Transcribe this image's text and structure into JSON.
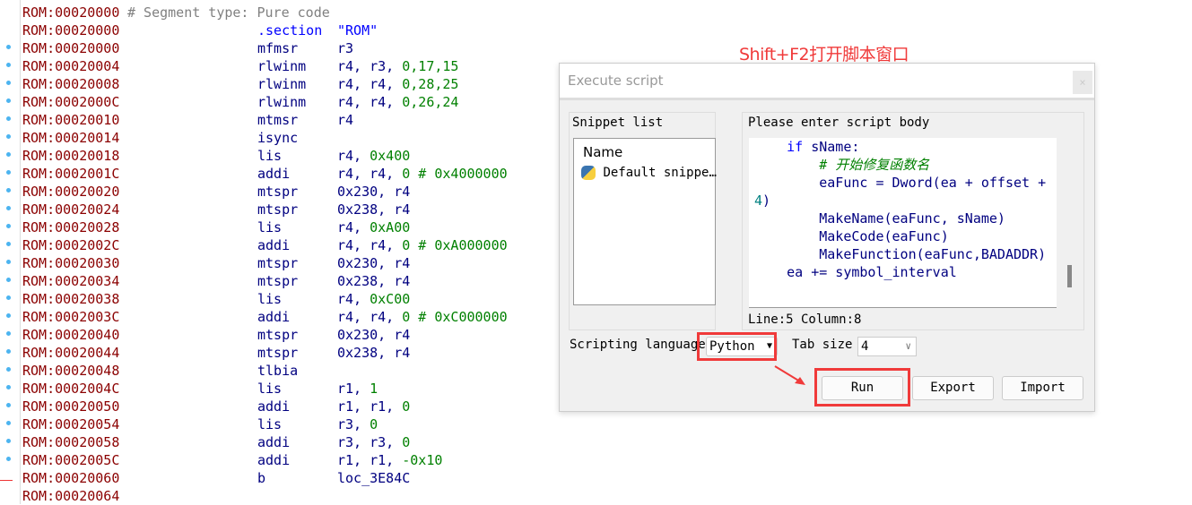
{
  "listing": [
    {
      "addr": "ROM:00020000",
      "comment": "# Segment type: Pure code",
      "dot": false
    },
    {
      "addr": "ROM:00020000",
      "mn": ".section",
      "mnKind": "dir",
      "ops": [
        {
          "t": "\"ROM\"",
          "k": "str"
        }
      ],
      "dot": false
    },
    {
      "addr": "ROM:00020000",
      "mn": "mfmsr",
      "ops": [
        {
          "t": "r3",
          "k": "reg"
        }
      ],
      "dot": true
    },
    {
      "addr": "ROM:00020004",
      "mn": "rlwinm",
      "ops": [
        {
          "t": "r4, r3, ",
          "k": "reg"
        },
        {
          "t": "0,17,15",
          "k": "num"
        }
      ],
      "dot": true
    },
    {
      "addr": "ROM:00020008",
      "mn": "rlwinm",
      "ops": [
        {
          "t": "r4, r4, ",
          "k": "reg"
        },
        {
          "t": "0,28,25",
          "k": "num"
        }
      ],
      "dot": true
    },
    {
      "addr": "ROM:0002000C",
      "mn": "rlwinm",
      "ops": [
        {
          "t": "r4, r4, ",
          "k": "reg"
        },
        {
          "t": "0,26,24",
          "k": "num"
        }
      ],
      "dot": true
    },
    {
      "addr": "ROM:00020010",
      "mn": "mtmsr",
      "ops": [
        {
          "t": "r4",
          "k": "reg"
        }
      ],
      "dot": true
    },
    {
      "addr": "ROM:00020014",
      "mn": "isync",
      "ops": [],
      "dot": true
    },
    {
      "addr": "ROM:00020018",
      "mn": "lis",
      "ops": [
        {
          "t": "r4, ",
          "k": "reg"
        },
        {
          "t": "0x400",
          "k": "num"
        }
      ],
      "dot": true
    },
    {
      "addr": "ROM:0002001C",
      "mn": "addi",
      "ops": [
        {
          "t": "r4, r4, ",
          "k": "reg"
        },
        {
          "t": "0 # 0x4000000",
          "k": "num"
        }
      ],
      "dot": true
    },
    {
      "addr": "ROM:00020020",
      "mn": "mtspr",
      "ops": [
        {
          "t": "0x230, r4",
          "k": "reg"
        }
      ],
      "dot": true
    },
    {
      "addr": "ROM:00020024",
      "mn": "mtspr",
      "ops": [
        {
          "t": "0x238, r4",
          "k": "reg"
        }
      ],
      "dot": true
    },
    {
      "addr": "ROM:00020028",
      "mn": "lis",
      "ops": [
        {
          "t": "r4, ",
          "k": "reg"
        },
        {
          "t": "0xA00",
          "k": "num"
        }
      ],
      "dot": true
    },
    {
      "addr": "ROM:0002002C",
      "mn": "addi",
      "ops": [
        {
          "t": "r4, r4, ",
          "k": "reg"
        },
        {
          "t": "0 # 0xA000000",
          "k": "num"
        }
      ],
      "dot": true
    },
    {
      "addr": "ROM:00020030",
      "mn": "mtspr",
      "ops": [
        {
          "t": "0x230, r4",
          "k": "reg"
        }
      ],
      "dot": true
    },
    {
      "addr": "ROM:00020034",
      "mn": "mtspr",
      "ops": [
        {
          "t": "0x238, r4",
          "k": "reg"
        }
      ],
      "dot": true
    },
    {
      "addr": "ROM:00020038",
      "mn": "lis",
      "ops": [
        {
          "t": "r4, ",
          "k": "reg"
        },
        {
          "t": "0xC00",
          "k": "num"
        }
      ],
      "dot": true
    },
    {
      "addr": "ROM:0002003C",
      "mn": "addi",
      "ops": [
        {
          "t": "r4, r4, ",
          "k": "reg"
        },
        {
          "t": "0 # 0xC000000",
          "k": "num"
        }
      ],
      "dot": true
    },
    {
      "addr": "ROM:00020040",
      "mn": "mtspr",
      "ops": [
        {
          "t": "0x230, r4",
          "k": "reg"
        }
      ],
      "dot": true
    },
    {
      "addr": "ROM:00020044",
      "mn": "mtspr",
      "ops": [
        {
          "t": "0x238, r4",
          "k": "reg"
        }
      ],
      "dot": true
    },
    {
      "addr": "ROM:00020048",
      "mn": "tlbia",
      "ops": [],
      "dot": true
    },
    {
      "addr": "ROM:0002004C",
      "mn": "lis",
      "ops": [
        {
          "t": "r1, ",
          "k": "reg"
        },
        {
          "t": "1",
          "k": "num"
        }
      ],
      "dot": true
    },
    {
      "addr": "ROM:00020050",
      "mn": "addi",
      "ops": [
        {
          "t": "r1, r1, ",
          "k": "reg"
        },
        {
          "t": "0",
          "k": "num"
        }
      ],
      "dot": true
    },
    {
      "addr": "ROM:00020054",
      "mn": "lis",
      "ops": [
        {
          "t": "r3, ",
          "k": "reg"
        },
        {
          "t": "0",
          "k": "num"
        }
      ],
      "dot": true
    },
    {
      "addr": "ROM:00020058",
      "mn": "addi",
      "ops": [
        {
          "t": "r3, r3, ",
          "k": "reg"
        },
        {
          "t": "0",
          "k": "num"
        }
      ],
      "dot": true
    },
    {
      "addr": "ROM:0002005C",
      "mn": "addi",
      "ops": [
        {
          "t": "r1, r1, ",
          "k": "reg"
        },
        {
          "t": "-0x10",
          "k": "num"
        }
      ],
      "dot": true
    },
    {
      "addr": "ROM:00020060",
      "mn": "b",
      "ops": [
        {
          "t": "loc_3E84C",
          "k": "reg"
        }
      ],
      "dot": false
    },
    {
      "addr": "ROM:00020064",
      "dot": false
    }
  ],
  "caption": "Shift+F2打开脚本窗口",
  "dialog": {
    "title": "Execute script",
    "close": "×",
    "snippet_label": "Snippet list",
    "list_header": "Name",
    "snippets": [
      {
        "name": "Default snippe…",
        "icon": "python-icon"
      }
    ],
    "body_label": "Please enter script body",
    "code": [
      {
        "indent": "    ",
        "parts": [
          {
            "t": "if",
            "c": "#0000ff"
          },
          {
            "t": " sName:",
            "c": "#000080"
          }
        ]
      },
      {
        "indent": "        ",
        "parts": [
          {
            "t": "# 开始修复函数名",
            "c": "#008000"
          }
        ]
      },
      {
        "indent": "        ",
        "parts": [
          {
            "t": "eaFunc = Dword(ea + offset +",
            "c": "#000080"
          }
        ]
      },
      {
        "indent": "",
        "parts": [
          {
            "t": "4",
            "c": "#008080"
          },
          {
            "t": ")",
            "c": "#000080"
          }
        ]
      },
      {
        "indent": "        ",
        "parts": [
          {
            "t": "MakeName(eaFunc, sName)",
            "c": "#000080"
          }
        ]
      },
      {
        "indent": "        ",
        "parts": [
          {
            "t": "MakeCode(eaFunc)",
            "c": "#000080"
          }
        ]
      },
      {
        "indent": "        ",
        "parts": [
          {
            "t": "MakeFunction(eaFunc,BADADDR)",
            "c": "#000080"
          }
        ]
      },
      {
        "indent": "    ",
        "parts": [
          {
            "t": "ea += symbol_interval",
            "c": "#000080"
          }
        ]
      }
    ],
    "status": "Line:5  Column:8",
    "lang_label": "Scripting language",
    "lang_value": "Python",
    "tab_label": "Tab size",
    "tab_value": "4",
    "run": "Run",
    "export": "Export",
    "import": "Import"
  },
  "colors": {
    "highlight": "#f03a3a",
    "address": "#8b0000"
  }
}
